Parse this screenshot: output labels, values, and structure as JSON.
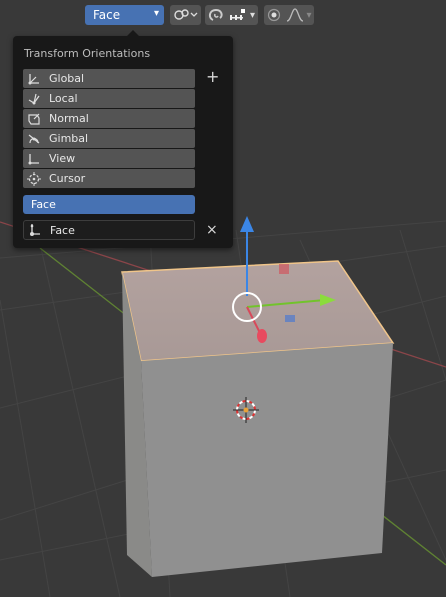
{
  "header": {
    "orientation_selected": "Face"
  },
  "popover": {
    "title": "Transform Orientations",
    "add_label": "+",
    "items": [
      {
        "label": "Global",
        "icon": "orientation-global-icon"
      },
      {
        "label": "Local",
        "icon": "orientation-local-icon"
      },
      {
        "label": "Normal",
        "icon": "orientation-normal-icon"
      },
      {
        "label": "Gimbal",
        "icon": "orientation-gimbal-icon"
      },
      {
        "label": "View",
        "icon": "orientation-view-icon"
      },
      {
        "label": "Cursor",
        "icon": "orientation-cursor-icon"
      }
    ],
    "custom_selected": "Face",
    "custom_name": "Face",
    "remove_label": "×"
  },
  "colors": {
    "accent_blue": "#4772b3",
    "axis_x": "#e84a5f",
    "axis_y": "#8bdc3c",
    "axis_z": "#4a8ae8",
    "viewport_bg": "#393939"
  }
}
